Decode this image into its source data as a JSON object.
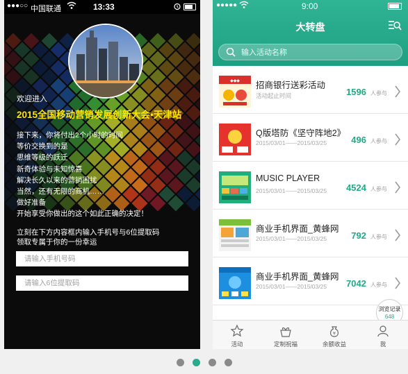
{
  "left_screen": {
    "status_bar": {
      "signal": "●●●○○",
      "carrier": "中国联通",
      "time": "13:33"
    },
    "welcome": "欢迎进入",
    "event_title": "2015全国移动营销发展创新大会•天津站",
    "description_lines": [
      "接下来，你将付出2个小时的时间",
      "等价交换到的是",
      "思维等级的跃迁",
      "新奇体验与未知惊喜",
      "解决长久以来的营销困扰",
      "当然，还有无限的商机……",
      "做好准备",
      "开始享受你做出的这个如此正确的决定！"
    ],
    "instruction_lines": [
      "立刻在下方内容框内输入手机号与6位提取码",
      "领取专属于你的一份幸运"
    ],
    "phone_input": {
      "placeholder": "请输入手机号码",
      "value": ""
    },
    "code_input": {
      "placeholder": "请输入6位提取码",
      "value": ""
    }
  },
  "right_screen": {
    "status_bar": {
      "signal": "●●●●●",
      "time": "9:00"
    },
    "title": "大转盘",
    "search": {
      "placeholder": "输入活动名称",
      "value": ""
    },
    "participants_label": "人参与",
    "activities": [
      {
        "name": "招商银行送彩活动",
        "date": "活动起止时间",
        "count": "1596",
        "thumb": "cmb"
      },
      {
        "name": "Q版塔防《坚守阵地2》",
        "date": "2015/03/01——2015/03/25",
        "count": "496",
        "thumb": "red"
      },
      {
        "name": "MUSIC PLAYER",
        "date": "2015/03/01——2015/03/25",
        "count": "4524",
        "thumb": "green"
      },
      {
        "name": "商业手机界面_黄蜂网",
        "date": "2015/03/01——2015/03/25",
        "count": "792",
        "thumb": "site"
      },
      {
        "name": "商业手机界面_黄蜂网",
        "date": "2015/03/01——2015/03/25",
        "count": "7042",
        "thumb": "blue"
      }
    ],
    "history": {
      "label": "浏览记录",
      "count": "648"
    },
    "tabs": [
      {
        "label": "活动",
        "icon": "star-icon"
      },
      {
        "label": "定制祝福",
        "icon": "gift-icon"
      },
      {
        "label": "余额收益",
        "icon": "money-bag-icon"
      },
      {
        "label": "我",
        "icon": "person-icon"
      }
    ],
    "accent_color": "#23a887"
  },
  "pager": {
    "count": 4,
    "active_index": 1
  }
}
